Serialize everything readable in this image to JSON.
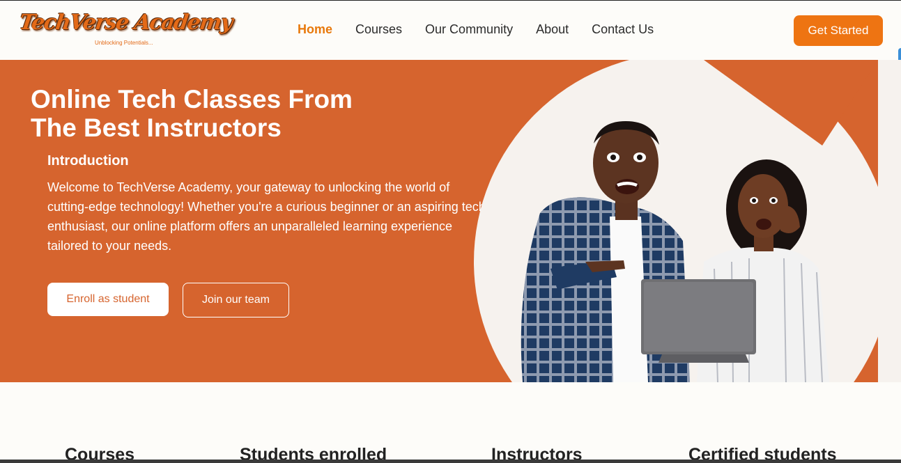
{
  "brand": {
    "logo_text": "TechVerse Academy",
    "tagline": "Unblocking Potentials..."
  },
  "nav": {
    "links": [
      {
        "label": "Home",
        "active": true
      },
      {
        "label": "Courses",
        "active": false
      },
      {
        "label": "Our Community",
        "active": false
      },
      {
        "label": "About",
        "active": false
      },
      {
        "label": "Contact Us",
        "active": false
      }
    ],
    "cta_label": "Get Started"
  },
  "hero": {
    "title_line1": "Online Tech Classes From",
    "title_line2": "The Best Instructors",
    "intro_heading": "Introduction",
    "intro_text": "Welcome to TechVerse Academy, your gateway to unlocking the world of cutting-edge technology! Whether you're a curious beginner or an aspiring tech enthusiast, our online platform offers an unparalleled learning experience tailored to your needs.",
    "enroll_label": "Enroll as student",
    "join_label": "Join our team"
  },
  "stats": {
    "labels": [
      "Courses",
      "Students enrolled",
      "Instructors",
      "Certified students"
    ]
  },
  "colors": {
    "accent": "#ee7412",
    "hero_bg": "#d6642e",
    "active_nav": "#e8790c"
  }
}
